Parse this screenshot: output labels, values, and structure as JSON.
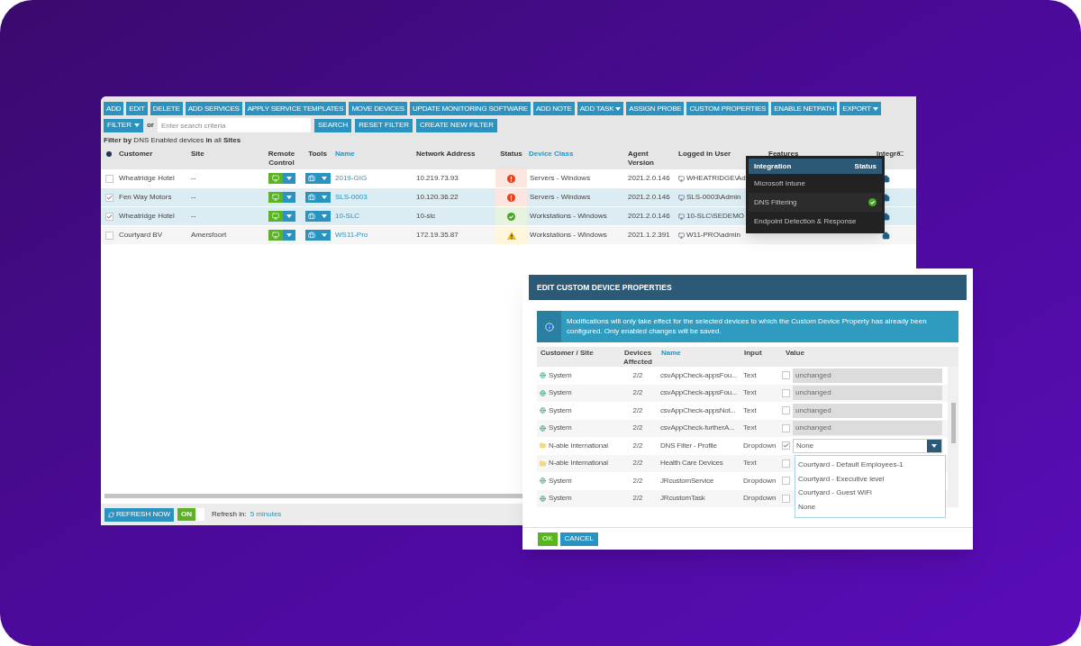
{
  "toolbar": {
    "buttons": [
      {
        "label": "ADD",
        "menu": false
      },
      {
        "label": "EDIT",
        "menu": false
      },
      {
        "label": "DELETE",
        "menu": false
      },
      {
        "label": "ADD SERVICES",
        "menu": false
      },
      {
        "label": "APPLY SERVICE TEMPLATES",
        "menu": false
      },
      {
        "label": "MOVE DEVICES",
        "menu": false
      },
      {
        "label": "UPDATE MONITORING SOFTWARE",
        "menu": false
      },
      {
        "label": "ADD NOTE",
        "menu": false
      },
      {
        "label": "ADD TASK",
        "menu": true
      },
      {
        "label": "ASSIGN PROBE",
        "menu": false
      },
      {
        "label": "CUSTOM PROPERTIES",
        "menu": false
      },
      {
        "label": "ENABLE NETPATH",
        "menu": false
      },
      {
        "label": "EXPORT",
        "menu": true
      }
    ]
  },
  "filter_bar": {
    "filter_button": "FILTER",
    "or_label": "or",
    "search": {
      "placeholder": "Enter search criteria"
    },
    "buttons": [
      "SEARCH",
      "RESET FILTER",
      "CREATE NEW FILTER"
    ],
    "summary": "**Filter by** DNS Enabled devices **in** all **Sites**"
  },
  "table": {
    "select_all": {
      "checked": true
    },
    "columns": [
      "Customer",
      "Site",
      "Remote Control",
      "Tools",
      "Name",
      "Network Address",
      "Status",
      "Device Class",
      "Agent Version",
      "Logged in User",
      "Features",
      "Integra"
    ],
    "rows": [
      {
        "checked": false,
        "selected": false,
        "customer": "Wheatridge Hotel",
        "site": "--",
        "name": "2019-GIG",
        "address": "10.219.73.93",
        "kind": "error",
        "device_class": "Servers - Windows",
        "agent_version": "2021.2.0.146",
        "user": "WHEATRIDGE\\Ad"
      },
      {
        "checked": true,
        "selected": true,
        "customer": "Fen Way Motors",
        "site": "--",
        "name": "SLS-0003",
        "address": "10.120.36.22",
        "kind": "error",
        "device_class": "Servers - Windows",
        "agent_version": "2021.2.0.146",
        "user": "SLS-0003\\Admin"
      },
      {
        "checked": true,
        "selected": true,
        "customer": "Wheatridge Hotel",
        "site": "--",
        "name": "10-SLC",
        "address": "10-slc",
        "kind": "ok",
        "device_class": "Workstations - Windows",
        "agent_version": "2021.2.0.146",
        "user": "10-SLC\\SEDEMO"
      },
      {
        "checked": false,
        "selected": false,
        "customer": "Courtyard BV",
        "site": "Amersfoort",
        "name": "WS11-Pro",
        "address": "172.19.35.87",
        "kind": "warning",
        "device_class": "Workstations - Windows",
        "agent_version": "2021.1.2.391",
        "user": "W11-PRO\\admin"
      }
    ]
  },
  "integration_popup": {
    "columns": [
      "Integration",
      "Status"
    ],
    "items": [
      {
        "name": "Microsoft Intune",
        "enabled": false
      },
      {
        "name": "DNS Filtering",
        "enabled": true
      },
      {
        "name": "Endpoint Detection & Response",
        "enabled": false
      }
    ]
  },
  "footer": {
    "refresh_button": "REFRESH NOW",
    "toggle": {
      "label": "ON",
      "on": true
    },
    "refresh_label": "Refresh in:",
    "refresh_value": "5 minutes"
  },
  "dialog": {
    "title": "EDIT CUSTOM DEVICE PROPERTIES",
    "info": "Modifications will only take effect for the selected devices to which the Custom Device Property has already been configured. Only enabled changes will be saved.",
    "columns": [
      "Customer / Site",
      "Devices Affected",
      "Name",
      "Input",
      "Value"
    ],
    "rows": [
      {
        "kind": "system",
        "customer": "System",
        "devices": "2/2",
        "name": "csvAppCheck-appsFou...",
        "input": "Text",
        "checked": false,
        "value": "unchanged"
      },
      {
        "kind": "system",
        "customer": "System",
        "devices": "2/2",
        "name": "csvAppCheck-appsFou...",
        "input": "Text",
        "checked": false,
        "value": "unchanged"
      },
      {
        "kind": "system",
        "customer": "System",
        "devices": "2/2",
        "name": "csvAppCheck-appsNot...",
        "input": "Text",
        "checked": false,
        "value": "unchanged"
      },
      {
        "kind": "system",
        "customer": "System",
        "devices": "2/2",
        "name": "csvAppCheck-furtherA...",
        "input": "Text",
        "checked": false,
        "value": "unchanged"
      },
      {
        "kind": "folder",
        "customer": "N-able International",
        "devices": "2/2",
        "name": "DNS Filter - Profile",
        "input": "Dropdown",
        "checked": true,
        "value": "None",
        "expanded": true,
        "options": [
          "Courtyard - Default Employees-1",
          "Courtyard - Executive level",
          "Courtyard - Guest WiFi",
          "None"
        ]
      },
      {
        "kind": "folder",
        "customer": "N-able International",
        "devices": "2/2",
        "name": "Health Care Devices",
        "input": "Text",
        "checked": false
      },
      {
        "kind": "system",
        "customer": "System",
        "devices": "2/2",
        "name": "JRcustomService",
        "input": "Dropdown",
        "checked": false
      },
      {
        "kind": "system",
        "customer": "System",
        "devices": "2/2",
        "name": "JRcustomTask",
        "input": "Dropdown",
        "checked": false
      }
    ],
    "buttons": [
      {
        "label": "OK",
        "kind": "primary"
      },
      {
        "label": "CANCEL",
        "kind": "secondary"
      }
    ]
  }
}
